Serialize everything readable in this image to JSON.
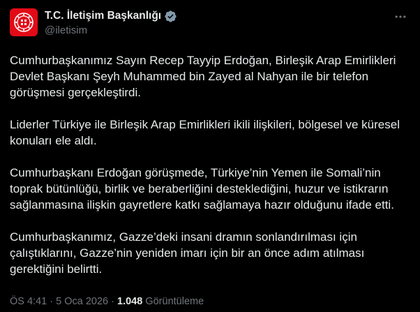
{
  "account": {
    "display_name": "T.C. İletişim Başkanlığı",
    "handle": "@iletisim",
    "verified": true,
    "avatar_color": "#e30a17",
    "verified_badge_color": "#829aab"
  },
  "tweet": {
    "paragraphs": [
      "Cumhurbaşkanımız Sayın Recep Tayyip Erdoğan, Birleşik Arap Emirlikleri Devlet Başkanı Şeyh Muhammed bin Zayed al Nahyan ile bir telefon görüşmesi gerçekleştirdi.",
      "Liderler Türkiye ile Birleşik Arap Emirlikleri ikili ilişkileri, bölgesel ve küresel konuları ele aldı.",
      "Cumhurbaşkanı Erdoğan görüşmede, Türkiye’nin Yemen ile Somali’nin toprak bütünlüğü, birlik ve beraberliğini desteklediğini, huzur ve istikrarın sağlanmasına ilişkin gayretlere katkı sağlamaya hazır olduğunu ifade etti.",
      "Cumhurbaşkanımız, Gazze’deki insani dramın sonlandırılması için çalıştıklarını, Gazze’nin yeniden imarı için bir an önce adım atılması gerektiğini belirtti."
    ]
  },
  "meta": {
    "time": "ÖS 4:41",
    "separator": "·",
    "date": "5 Oca 2026",
    "views_count": "1.048",
    "views_label": "Görüntüleme"
  },
  "icons": {
    "more": "more-horizontal-icon",
    "verified": "verified-badge-icon",
    "logo": "seal-logo-icon"
  }
}
